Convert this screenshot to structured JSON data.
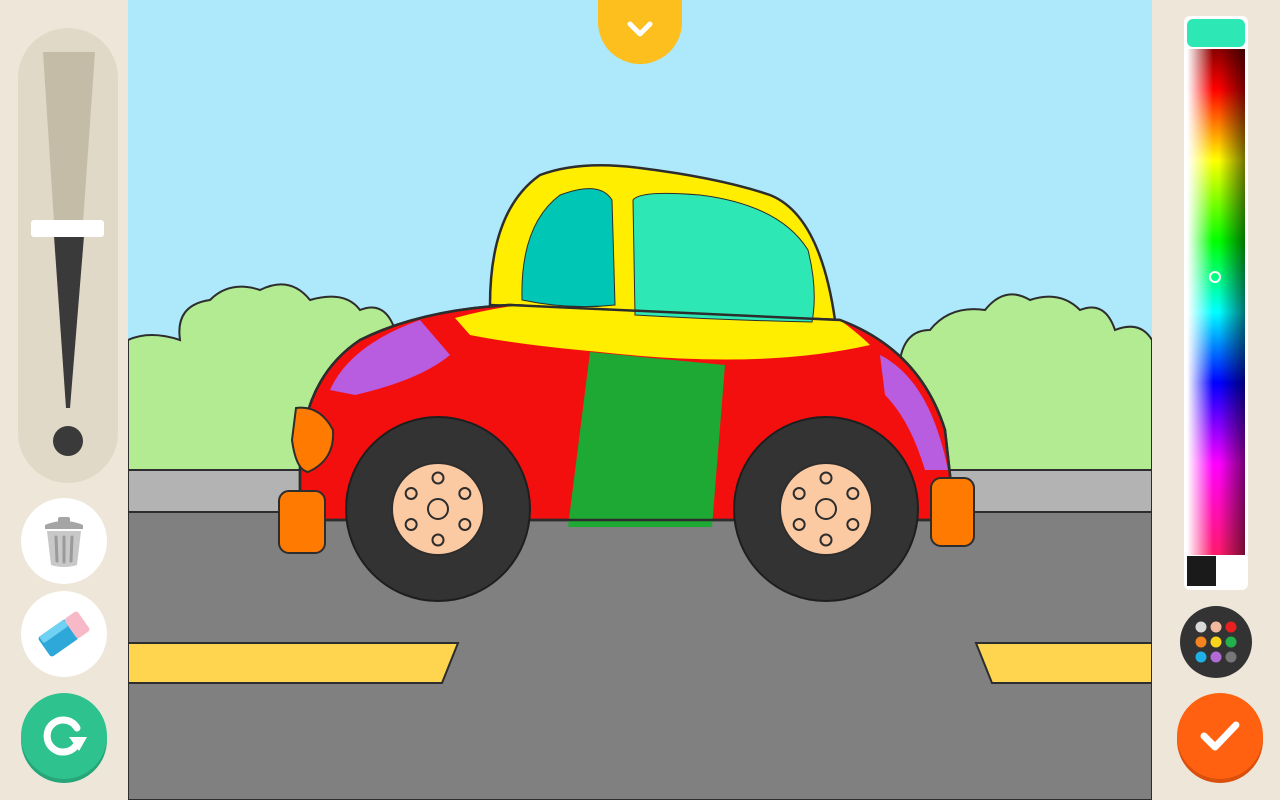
{
  "app": {
    "accent_teal": "#2ec28e",
    "accent_orange": "#ff6111",
    "accent_yellow": "#fcbf1e",
    "panel_bg": "#ede6d9"
  },
  "left_toolbar": {
    "brush_size": {
      "icon": "brush-size-icon",
      "level": 0.44
    },
    "tools": [
      {
        "name": "trash",
        "icon": "trash-icon"
      },
      {
        "name": "eraser",
        "icon": "eraser-icon"
      },
      {
        "name": "undo",
        "icon": "redo-arrow-icon"
      }
    ]
  },
  "top_tab": {
    "icon": "chevron-down-icon"
  },
  "right_toolbar": {
    "selected_color": "#2de8b4",
    "palette_button": {
      "icon": "color-dots-icon",
      "dots": [
        "#d9d9d9",
        "#f3b8a0",
        "#e82020",
        "#f5841f",
        "#f7d51b",
        "#22b14c",
        "#1eb0e6",
        "#b06bd6",
        "#777777"
      ]
    },
    "done_button": {
      "icon": "checkmark-icon"
    }
  },
  "scene": {
    "sky_color": "#aee8fb",
    "bush_color": "#b2eb91",
    "road_color": "#808080",
    "curb_color": "#b3b3b3",
    "lane_color": "#ffd54f",
    "car_colors": {
      "roof": "#ffee00",
      "window_front": "#00c6b6",
      "window_rear": "#2de8b4",
      "body": "#f40f0f",
      "door": "#1ea834",
      "fender": "#b85ce0",
      "light": "#ff7a00",
      "tire": "#333333",
      "hub": "#fbc9a2"
    }
  }
}
